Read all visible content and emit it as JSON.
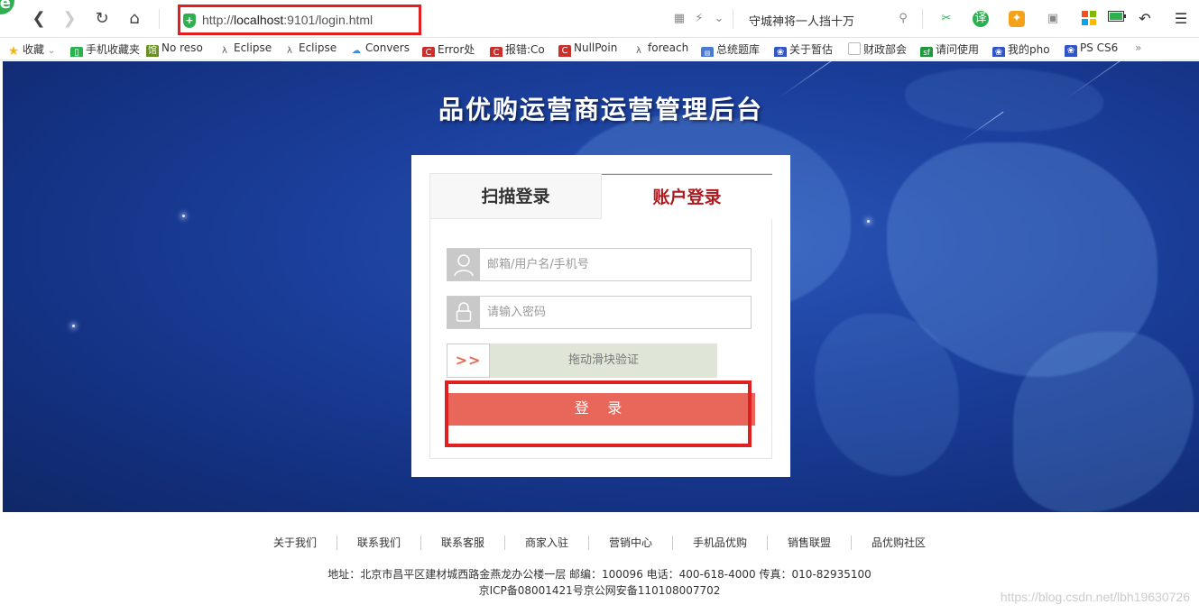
{
  "browser": {
    "url_prefix": "http://",
    "url_host": "localhost",
    "url_rest": ":9101/login.html",
    "search_text": "守城神将一人挡十万"
  },
  "bookmarks": [
    {
      "label": "收藏",
      "icon": "star-icon",
      "color": "#f3b51a"
    },
    {
      "label": "手机收藏夹",
      "icon": "phone-icon",
      "color": "#2db14f"
    },
    {
      "label": "No reso",
      "icon": "bookmark-icon",
      "color": "#6b8e23"
    },
    {
      "label": "Eclipse",
      "icon": "eclipse-icon",
      "color": "#555"
    },
    {
      "label": "Eclipse",
      "icon": "eclipse-icon",
      "color": "#555"
    },
    {
      "label": "Convers",
      "icon": "cloud-icon",
      "color": "#3b8ed8"
    },
    {
      "label": "Error处",
      "icon": "c-icon",
      "color": "#c9302c"
    },
    {
      "label": "报错:Co",
      "icon": "c-icon",
      "color": "#c9302c"
    },
    {
      "label": "NullPoin",
      "icon": "c-icon",
      "color": "#c9302c"
    },
    {
      "label": "foreach",
      "icon": "eclipse-icon",
      "color": "#555"
    },
    {
      "label": "总统题库",
      "icon": "doc-icon",
      "color": "#4a7bd4"
    },
    {
      "label": "关于暂估",
      "icon": "paw-icon",
      "color": "#3055c8"
    },
    {
      "label": "财政部会",
      "icon": "page-icon",
      "color": "#999"
    },
    {
      "label": "请问使用",
      "icon": "sf-icon",
      "color": "#1a9a3a"
    },
    {
      "label": "我的pho",
      "icon": "paw-icon",
      "color": "#3055c8"
    },
    {
      "label": "PS CS6",
      "icon": "paw-icon",
      "color": "#3055c8"
    }
  ],
  "hero": {
    "title": "品优购运营商运营管理后台"
  },
  "login": {
    "tab_scan": "扫描登录",
    "tab_account": "账户登录",
    "username_placeholder": "邮箱/用户名/手机号",
    "password_placeholder": "请输入密码",
    "slider_handle": ">>",
    "slider_text": "拖动滑块验证",
    "submit_label": "登 录"
  },
  "footer": {
    "links": [
      "关于我们",
      "联系我们",
      "联系客服",
      "商家入驻",
      "营销中心",
      "手机品优购",
      "销售联盟",
      "品优购社区"
    ],
    "address": "地址：北京市昌平区建材城西路金燕龙办公楼一层 邮编：100096 电话：400-618-4000 传真：010-82935100",
    "icp": "京ICP备08001421号京公网安备110108007702",
    "watermark": "https://blog.csdn.net/lbh19630726"
  }
}
